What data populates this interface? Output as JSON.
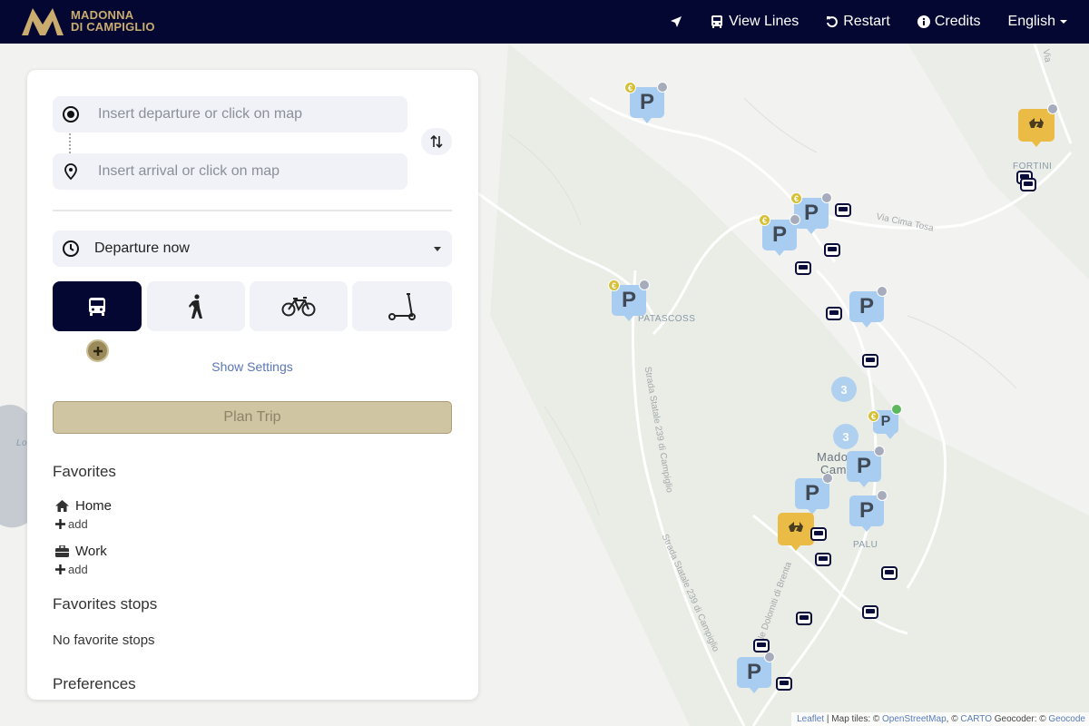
{
  "header": {
    "logo_line1": "MADONNA",
    "logo_line2": "DI CAMPIGLIO",
    "nav": {
      "locate_icon": "location-arrow-icon",
      "view_lines": "View Lines",
      "restart": "Restart",
      "credits": "Credits",
      "language": "English"
    }
  },
  "panel": {
    "departure_placeholder": "Insert departure or click on map",
    "arrival_placeholder": "Insert arrival or click on map",
    "departure_time": "Departure now",
    "modes": [
      "bus",
      "walk",
      "bike",
      "scooter"
    ],
    "active_mode": "bus",
    "show_settings": "Show Settings",
    "plan_trip": "Plan Trip",
    "favorites_title": "Favorites",
    "favorite_home": "Home",
    "favorite_work": "Work",
    "add_label": "add",
    "favorite_stops_title": "Favorites stops",
    "no_favorite_stops": "No favorite stops",
    "preferences_title": "Preferences"
  },
  "map": {
    "labels": {
      "fortini": "FORTINI",
      "patascoss": "PATASCOSS",
      "madonna": "Mado",
      "campiglio": "Cam",
      "palu": "PALU",
      "loc": "Lo",
      "via_cima_tosa": "Via Cima Tosa",
      "strada_statale_1": "Strada Statale 239 di Campiglio",
      "strada_statale_2": "Strada Statale 239 di Campiglio",
      "viale_dolomiti": "Viale Dolomiti di Brenta",
      "via_top": "Via"
    },
    "parking_letter": "P",
    "euro_symbol": "€",
    "clusters": [
      "3",
      "3"
    ],
    "attribution": {
      "leaflet": "Leaflet",
      "map_tiles": "| Map tiles: ©",
      "osm": "OpenStreetMap",
      "sep": ", ©",
      "carto": "CARTO",
      "geocoder": "Geocoder: ©",
      "geocoder_link": "Geocode"
    }
  },
  "colors": {
    "header_bg": "#050733",
    "gold": "#c9ac6e",
    "parking": "#a9cdf0",
    "charging": "#ebbc45",
    "plan_button": "#cfc5a2"
  }
}
